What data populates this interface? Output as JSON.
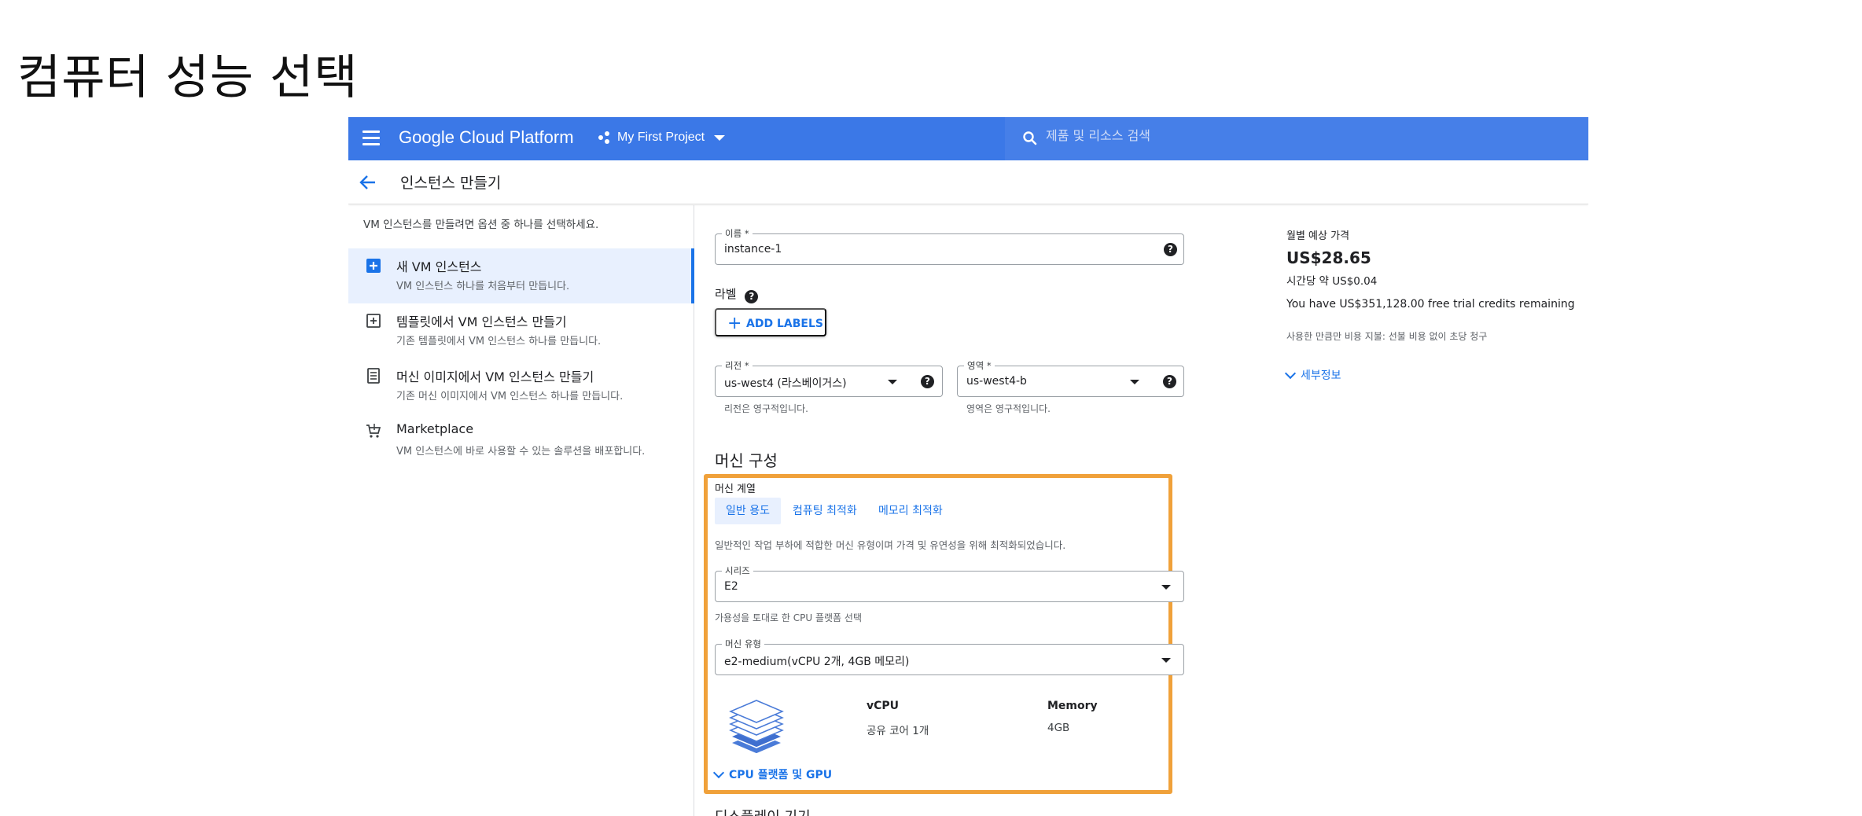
{
  "slide_title": "컴퓨터 성능 선택",
  "topbar": {
    "brand": "Google Cloud Platform",
    "project": "My First Project",
    "search_placeholder": "제품 및 리소스 검색",
    "color": "#3b78e7"
  },
  "page": {
    "title": "인스턴스 만들기"
  },
  "left": {
    "intro": "VM 인스턴스를 만들려면 옵션 중 하나를 선택하세요.",
    "options": [
      {
        "title": "새 VM 인스턴스",
        "desc": "VM 인스턴스 하나를 처음부터 만듭니다.",
        "icon": "add-box-icon"
      },
      {
        "title": "템플릿에서 VM 인스턴스 만들기",
        "desc": "기존 템플릿에서 VM 인스턴스 하나를 만듭니다.",
        "icon": "template-icon"
      },
      {
        "title": "머신 이미지에서 VM 인스턴스 만들기",
        "desc": "기존 머신 이미지에서 VM 인스턴스 하나를 만듭니다.",
        "icon": "machine-image-icon"
      },
      {
        "title": "Marketplace",
        "desc": "VM 인스턴스에 바로 사용할 수 있는 솔루션을 배포합니다.",
        "icon": "cart-icon"
      }
    ]
  },
  "form": {
    "name_label": "이름 *",
    "name_value": "instance-1",
    "labels_heading": "라벨",
    "add_labels": "ADD LABELS",
    "region_label": "리전 *",
    "region_value": "us-west4 (라스베이거스)",
    "region_hint": "리전은 영구적입니다.",
    "zone_label": "영역 *",
    "zone_value": "us-west4-b",
    "zone_hint": "영역은 영구적입니다.",
    "machine_config_title": "머신 구성",
    "machine_family_label": "머신 계열",
    "tabs": [
      "일반 용도",
      "컴퓨팅 최적화",
      "메모리 최적화"
    ],
    "family_desc": "일반적인 작업 부하에 적합한 머신 유형이며 가격 및 유연성을 위해 최적화되었습니다.",
    "series_label": "시리즈",
    "series_value": "E2",
    "series_hint": "가용성을 토대로 한 CPU 플랫폼 선택",
    "machine_type_label": "머신 유형",
    "machine_type_value": "e2-medium(vCPU 2개, 4GB 메모리)",
    "vcpu_heading": "vCPU",
    "vcpu_value": "공유 코어 1개",
    "memory_heading": "Memory",
    "memory_value": "4GB",
    "cpu_link": "CPU 플랫폼 및 GPU",
    "display_title": "디스플레이 기기",
    "highlight_color": "#f0a13a"
  },
  "pricing": {
    "label": "월별 예상 가격",
    "price": "US$28.65",
    "hourly": "시간당 약 US$0.04",
    "credits": "You have US$351,128.00 free trial credits remaining",
    "note": "사용한 만큼만 비용 지불: 선불 비용 없이 초당 청구",
    "details": "세부정보"
  }
}
